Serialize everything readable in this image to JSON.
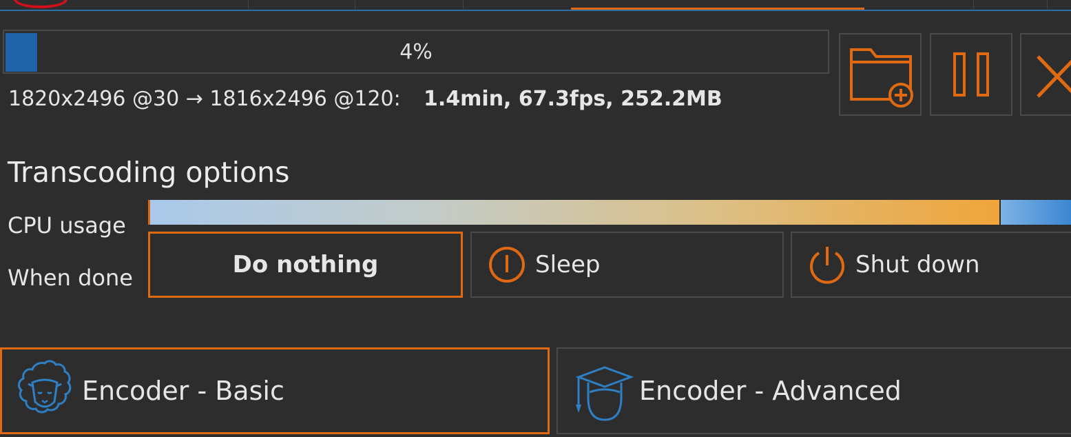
{
  "progress": {
    "percent_label": "4%",
    "value": 0.04
  },
  "job": {
    "conversion": "1820x2496 @30 → 1816x2496 @120:",
    "stats": "1.4min, 67.3fps, 252.2MB"
  },
  "toolbar": {
    "icons": [
      "folder-add-icon",
      "pause-icon",
      "close-icon"
    ]
  },
  "transcoding": {
    "title": "Transcoding options",
    "cpu_label": "CPU usage",
    "cpu_level": 0.92,
    "when_done_label": "When done",
    "when_done_options": [
      {
        "label": "Do nothing",
        "selected": true
      },
      {
        "label": "Sleep",
        "icon": "sleep-icon",
        "selected": false
      },
      {
        "label": "Shut down",
        "icon": "power-icon",
        "selected": false
      }
    ]
  },
  "encoders": [
    {
      "label": "Encoder - Basic",
      "icon": "sheep-icon",
      "selected": true
    },
    {
      "label": "Encoder - Advanced",
      "icon": "graduate-icon",
      "selected": false
    }
  ],
  "colors": {
    "accent": "#e06a12",
    "progress": "#1f62a8",
    "blue_icon": "#2e7fc4",
    "background": "#2d2d2d"
  }
}
